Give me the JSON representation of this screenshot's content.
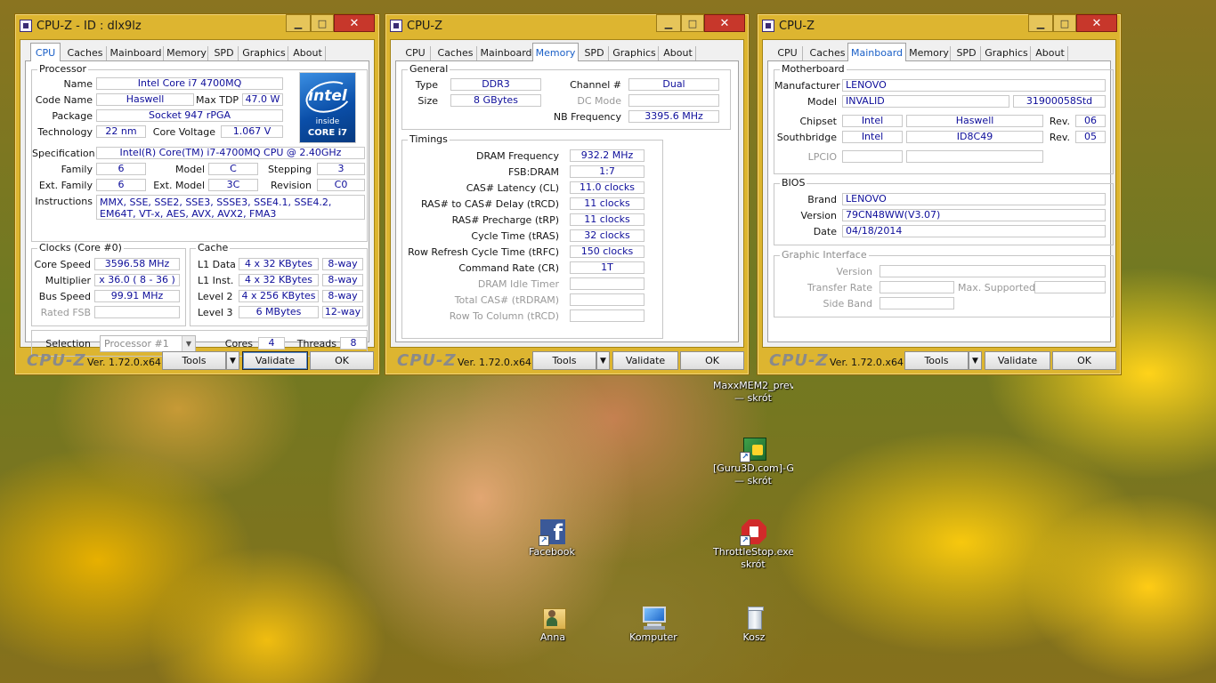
{
  "common": {
    "tabs": [
      "CPU",
      "Caches",
      "Mainboard",
      "Memory",
      "SPD",
      "Graphics",
      "About"
    ],
    "logo": "CPU-Z",
    "version": "Ver. 1.72.0.x64",
    "tools_label": "Tools",
    "validate_label": "Validate",
    "ok_label": "OK",
    "minimize": "▁",
    "maximize": "□",
    "close": "✕",
    "dropdown_arrow": "▼"
  },
  "win1": {
    "title": "CPU-Z - ID : dlx9lz",
    "active_tab": "CPU",
    "processor": {
      "legend": "Processor",
      "name_label": "Name",
      "name": "Intel Core i7 4700MQ",
      "codename_label": "Code Name",
      "codename": "Haswell",
      "maxtdp_label": "Max TDP",
      "maxtdp": "47.0 W",
      "package_label": "Package",
      "package": "Socket 947 rPGA",
      "technology_label": "Technology",
      "technology": "22 nm",
      "corevoltage_label": "Core Voltage",
      "corevoltage": "1.067 V",
      "specification_label": "Specification",
      "specification": "Intel(R) Core(TM) i7-4700MQ CPU @ 2.40GHz",
      "family_label": "Family",
      "family": "6",
      "model_label": "Model",
      "model": "C",
      "stepping_label": "Stepping",
      "stepping": "3",
      "extfamily_label": "Ext. Family",
      "extfamily": "6",
      "extmodel_label": "Ext. Model",
      "extmodel": "3C",
      "revision_label": "Revision",
      "revision": "C0",
      "instructions_label": "Instructions",
      "instructions": "MMX, SSE, SSE2, SSE3, SSSE3, SSE4.1, SSE4.2, EM64T, VT-x, AES, AVX, AVX2, FMA3"
    },
    "intel_logo": {
      "brand": "intel",
      "inside": "inside",
      "series": "CORE i7"
    },
    "clocks": {
      "legend": "Clocks (Core #0)",
      "corespeed_label": "Core Speed",
      "corespeed": "3596.58 MHz",
      "multiplier_label": "Multiplier",
      "multiplier": "x 36.0 ( 8 - 36 )",
      "busspeed_label": "Bus Speed",
      "busspeed": "99.91 MHz",
      "ratedfsb_label": "Rated FSB",
      "ratedfsb": ""
    },
    "cache": {
      "legend": "Cache",
      "l1data_label": "L1 Data",
      "l1data": "4 x 32 KBytes",
      "l1data_way": "8-way",
      "l1inst_label": "L1 Inst.",
      "l1inst": "4 x 32 KBytes",
      "l1inst_way": "8-way",
      "level2_label": "Level 2",
      "level2": "4 x 256 KBytes",
      "level2_way": "8-way",
      "level3_label": "Level 3",
      "level3": "6 MBytes",
      "level3_way": "12-way"
    },
    "selection_label": "Selection",
    "selection": "Processor #1",
    "cores_label": "Cores",
    "cores": "4",
    "threads_label": "Threads",
    "threads": "8"
  },
  "win2": {
    "title": "CPU-Z",
    "active_tab": "Memory",
    "general": {
      "legend": "General",
      "type_label": "Type",
      "type": "DDR3",
      "size_label": "Size",
      "size": "8 GBytes",
      "channel_label": "Channel #",
      "channel": "Dual",
      "dcmode_label": "DC Mode",
      "dcmode": "",
      "nbfreq_label": "NB Frequency",
      "nbfreq": "3395.6 MHz"
    },
    "timings": {
      "legend": "Timings",
      "rows": [
        {
          "label": "DRAM Frequency",
          "value": "932.2 MHz",
          "dim": false
        },
        {
          "label": "FSB:DRAM",
          "value": "1:7",
          "dim": false
        },
        {
          "label": "CAS# Latency (CL)",
          "value": "11.0 clocks",
          "dim": false
        },
        {
          "label": "RAS# to CAS# Delay (tRCD)",
          "value": "11 clocks",
          "dim": false
        },
        {
          "label": "RAS# Precharge (tRP)",
          "value": "11 clocks",
          "dim": false
        },
        {
          "label": "Cycle Time (tRAS)",
          "value": "32 clocks",
          "dim": false
        },
        {
          "label": "Row Refresh Cycle Time (tRFC)",
          "value": "150 clocks",
          "dim": false
        },
        {
          "label": "Command Rate (CR)",
          "value": "1T",
          "dim": false
        },
        {
          "label": "DRAM Idle Timer",
          "value": "",
          "dim": true
        },
        {
          "label": "Total CAS# (tRDRAM)",
          "value": "",
          "dim": true
        },
        {
          "label": "Row To Column (tRCD)",
          "value": "",
          "dim": true
        }
      ]
    }
  },
  "win3": {
    "title": "CPU-Z",
    "active_tab": "Mainboard",
    "motherboard": {
      "legend": "Motherboard",
      "manufacturer_label": "Manufacturer",
      "manufacturer": "LENOVO",
      "model_label": "Model",
      "model": "INVALID",
      "model_rev": "31900058Std",
      "chipset_label": "Chipset",
      "chipset_vendor": "Intel",
      "chipset_name": "Haswell",
      "chipset_rev_label": "Rev.",
      "chipset_rev": "06",
      "southbridge_label": "Southbridge",
      "sb_vendor": "Intel",
      "sb_name": "ID8C49",
      "sb_rev_label": "Rev.",
      "sb_rev": "05",
      "lpcio_label": "LPCIO",
      "lpcio_vendor": "",
      "lpcio_name": ""
    },
    "bios": {
      "legend": "BIOS",
      "brand_label": "Brand",
      "brand": "LENOVO",
      "version_label": "Version",
      "version": "79CN48WW(V3.07)",
      "date_label": "Date",
      "date": "04/18/2014"
    },
    "graphic_interface": {
      "legend": "Graphic Interface",
      "version_label": "Version",
      "version": "",
      "transferrate_label": "Transfer Rate",
      "transferrate": "",
      "maxsupported_label": "Max. Supported",
      "maxsupported": "",
      "sideband_label": "Side Band",
      "sideband": ""
    }
  },
  "desktop": {
    "icons": [
      {
        "label1": "MaxxMEM2_previe...",
        "label2": "— skrót"
      },
      {
        "label1": "[Guru3D.com]-GP...",
        "label2": "— skrót"
      },
      {
        "label1": "Facebook",
        "label2": ""
      },
      {
        "label1": "ThrottleStop.exe —",
        "label2": "skrót"
      },
      {
        "label1": "Anna",
        "label2": ""
      },
      {
        "label1": "Komputer",
        "label2": ""
      },
      {
        "label1": "Kosz",
        "label2": ""
      }
    ],
    "shortcut_arrow": "↗",
    "facebook_glyph": "f"
  }
}
